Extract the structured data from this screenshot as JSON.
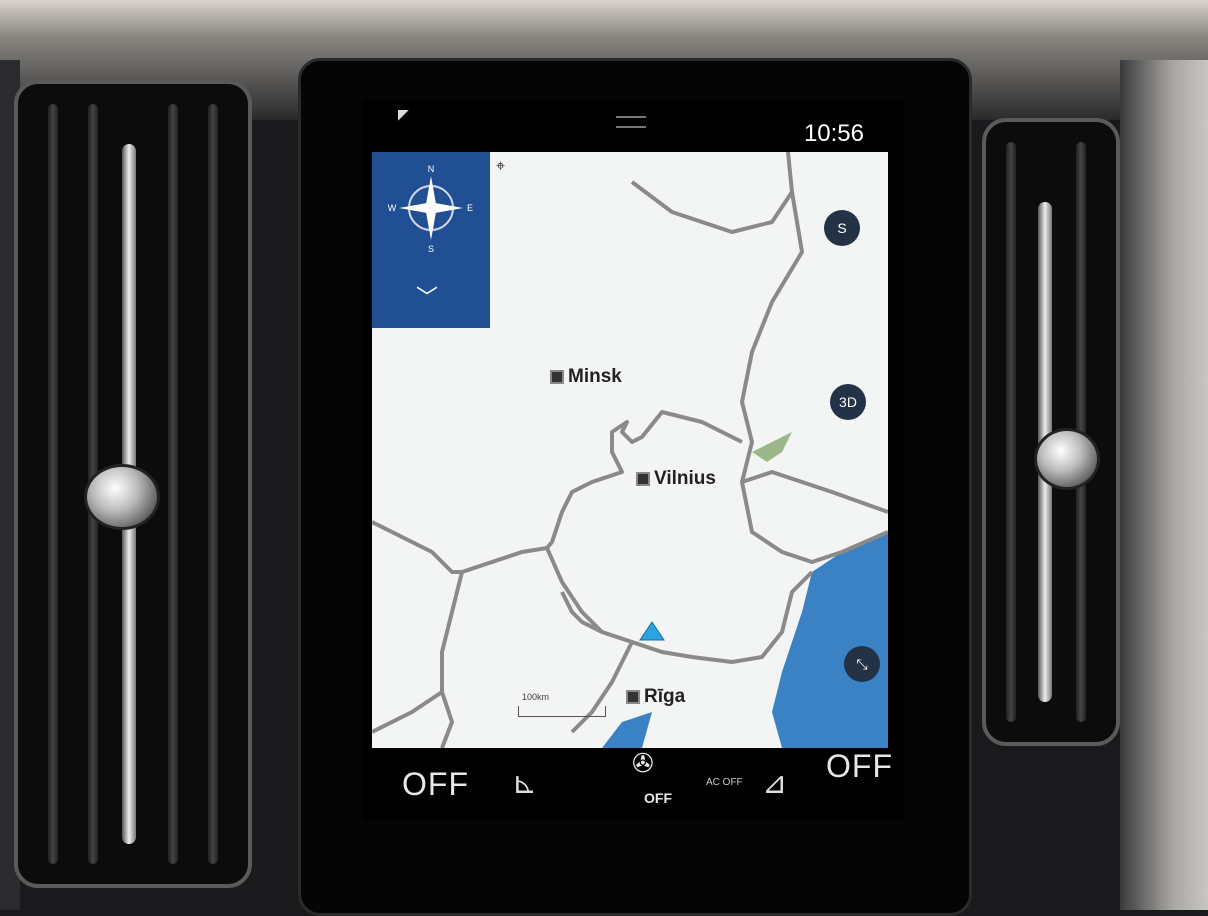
{
  "status_bar": {
    "time": "10:56"
  },
  "map": {
    "compass": {
      "n": "N",
      "s": "S",
      "e": "E",
      "w": "W"
    },
    "cities": [
      {
        "name": "Minsk"
      },
      {
        "name": "Vilnius"
      },
      {
        "name": "Rīga"
      }
    ],
    "buttons": {
      "compass_mode": "S",
      "view_3d": "3D"
    },
    "scale_label": "100km",
    "colors": {
      "panel": "#214f93",
      "water": "#3b82c4",
      "land": "#f3f4f4",
      "border": "#8a8a8a",
      "position": "#2aa3e0"
    }
  },
  "climate": {
    "left_temp": "OFF",
    "right_temp": "OFF",
    "fan": "OFF",
    "ac": "AC OFF",
    "fan_icon": "fan-icon",
    "left_seat_icon": "seat-heat-left-icon",
    "right_seat_icon": "seat-heat-right-icon"
  }
}
